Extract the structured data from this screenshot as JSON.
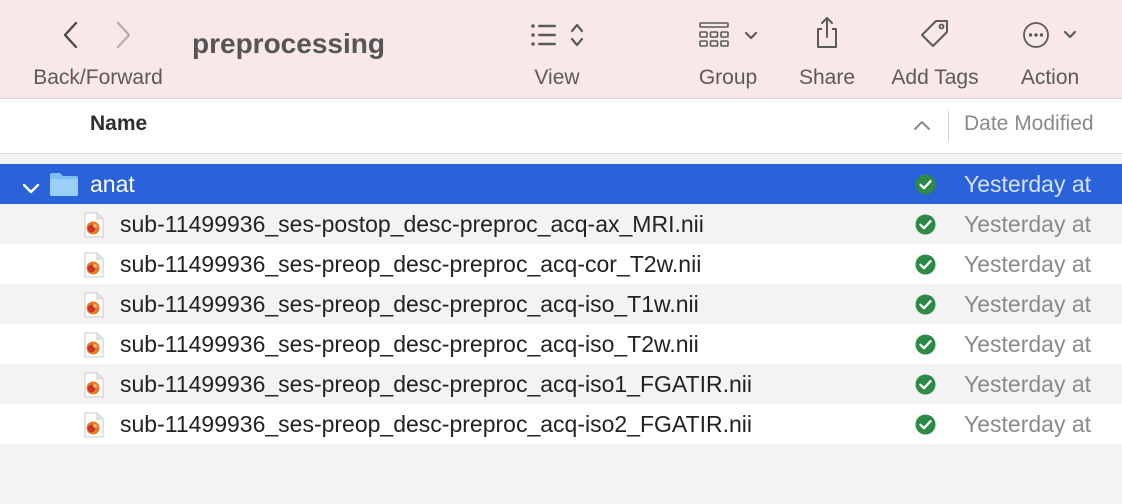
{
  "toolbar": {
    "back_forward_label": "Back/Forward",
    "title": "preprocessing",
    "view_label": "View",
    "group_label": "Group",
    "share_label": "Share",
    "add_tags_label": "Add Tags",
    "action_label": "Action"
  },
  "columns": {
    "name": "Name",
    "date_modified": "Date Modified"
  },
  "folder": {
    "name": "anat",
    "date": "Yesterday at",
    "expanded": true
  },
  "files": [
    {
      "name": "sub-11499936_ses-postop_desc-preproc_acq-ax_MRI.nii",
      "date": "Yesterday at"
    },
    {
      "name": "sub-11499936_ses-preop_desc-preproc_acq-cor_T2w.nii",
      "date": "Yesterday at"
    },
    {
      "name": "sub-11499936_ses-preop_desc-preproc_acq-iso_T1w.nii",
      "date": "Yesterday at"
    },
    {
      "name": "sub-11499936_ses-preop_desc-preproc_acq-iso_T2w.nii",
      "date": "Yesterday at"
    },
    {
      "name": "sub-11499936_ses-preop_desc-preproc_acq-iso1_FGATIR.nii",
      "date": "Yesterday at"
    },
    {
      "name": "sub-11499936_ses-preop_desc-preproc_acq-iso2_FGATIR.nii",
      "date": "Yesterday at"
    }
  ],
  "colors": {
    "toolbar_bg": "#f8e8e8",
    "selection": "#2962d9",
    "status_green": "#2e8b47"
  },
  "icons": [
    "back-icon",
    "forward-icon",
    "list-view-icon",
    "group-icon",
    "share-icon",
    "tag-icon",
    "action-ellipsis-icon",
    "folder-icon",
    "nii-file-icon",
    "synced-status-icon"
  ]
}
